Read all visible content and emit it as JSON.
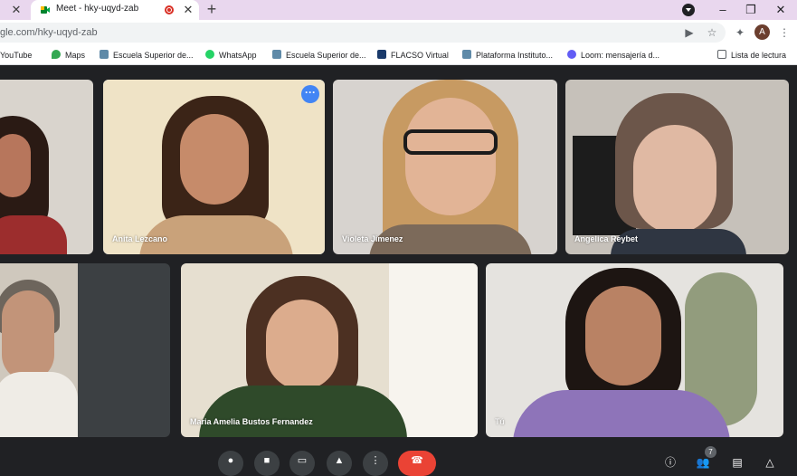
{
  "browser": {
    "tab_title": "Meet - hky-uqyd-zab",
    "new_tab": "+",
    "close_glyph": "✕",
    "url": "gle.com/hky-uqyd-zab",
    "avatar_letter": "A"
  },
  "bookmarks": [
    {
      "label": "YouTube",
      "icon_color": "#ff0000"
    },
    {
      "label": "Maps",
      "icon_color": "#34a853"
    },
    {
      "label": "Escuela Superior de...",
      "icon_color": "#5f8aa8"
    },
    {
      "label": "WhatsApp",
      "icon_color": "#25d366"
    },
    {
      "label": "Escuela Superior de...",
      "icon_color": "#5f8aa8"
    },
    {
      "label": "FLACSO Virtual",
      "icon_color": "#1a3a6b"
    },
    {
      "label": "Plataforma Instituto...",
      "icon_color": "#5f8aa8"
    },
    {
      "label": "Loom: mensajería d...",
      "icon_color": "#625df5"
    }
  ],
  "reading_list": "Lista de lectura",
  "participants": [
    {
      "name": "",
      "bg": "#d9d4cd",
      "skin": "#b7765c",
      "hair": "#2a1a14",
      "shirt": "#9c2d2d"
    },
    {
      "name": "Anita Lezcano",
      "bg": "#efe3c6",
      "skin": "#c68b6a",
      "hair": "#3b2417",
      "shirt": "#c9a27a"
    },
    {
      "name": "Violeta Jimenez",
      "bg": "#d7d3cf",
      "skin": "#e2b496",
      "hair": "#c79a62",
      "shirt": "#7c6a5a"
    },
    {
      "name": "Angelica Reybet",
      "bg": "#c6c1ba",
      "skin": "#e0b9a3",
      "hair": "#6c564a",
      "shirt": "#2f3642"
    },
    {
      "name": "",
      "bg": "#cfc8bd",
      "skin": "#c29479",
      "hair": "#6d655c",
      "shirt": "#efece6"
    },
    {
      "name": "Maria Amelia Bustos Fernandez",
      "bg": "#e6dfd0",
      "skin": "#dcac8d",
      "hair": "#4c3022",
      "shirt": "#2f4a2a"
    },
    {
      "name": "Tú",
      "bg": "#e5e3df",
      "skin": "#b98264",
      "hair": "#1d1512",
      "shirt": "#8e74b9"
    }
  ],
  "controls": {
    "participants_count": "7"
  }
}
